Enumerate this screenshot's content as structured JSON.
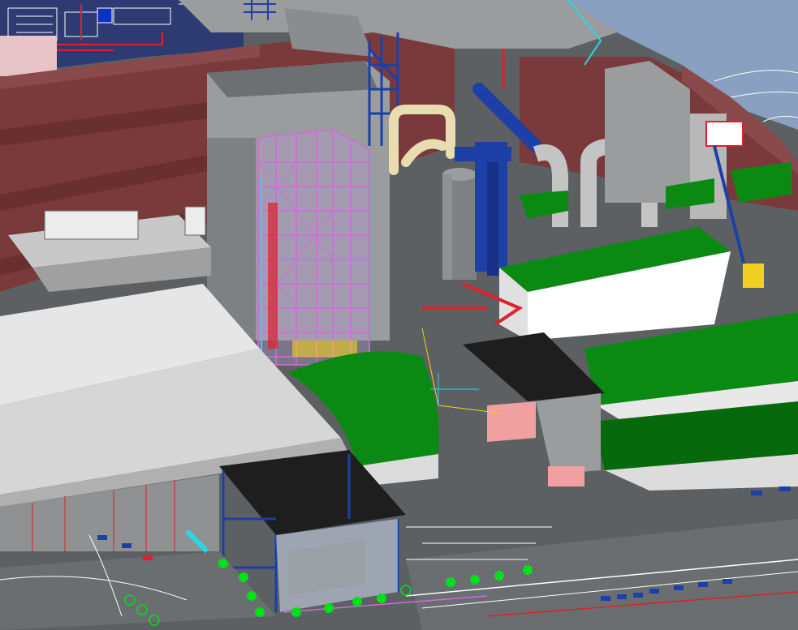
{
  "scene": {
    "kind": "3d-plant-model-viewport",
    "palette": {
      "ground": "#5c6063",
      "road": "#6a6e71",
      "roof_maroon": "#7a3a3c",
      "roof_maroon_light": "#8a4a4c",
      "wall_grey": "#b8b8b8",
      "wall_grey_dark": "#8f9193",
      "white_roof": "#dcdcdc",
      "green_roof": "#0a8a12",
      "green_dark": "#066a0c",
      "steel_blue": "#1c3fa8",
      "magenta_frame": "#d468e0",
      "cyan_line": "#28d8e8",
      "red_line": "#e0202a",
      "yellow": "#f0d020",
      "black_roof": "#1e1e1e",
      "pink_wall": "#f0a0a0",
      "sky_map": "#8aa0c0",
      "cad_white": "#ffffff"
    }
  }
}
